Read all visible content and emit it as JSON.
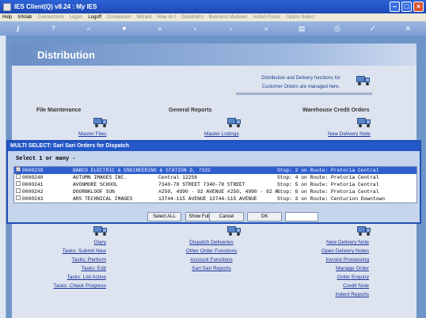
{
  "window": {
    "title": "IES Client(Q) v8.24 : My IES"
  },
  "menu": {
    "items": [
      {
        "label": "Help",
        "enabled": true
      },
      {
        "label": "Infolab",
        "enabled": true
      },
      {
        "label": "Connections",
        "enabled": false
      },
      {
        "label": "Logon",
        "enabled": false
      },
      {
        "label": "Logoff",
        "enabled": true
      },
      {
        "label": "Companion",
        "enabled": false
      },
      {
        "label": "Wizard",
        "enabled": false
      },
      {
        "label": "How do I",
        "enabled": false
      },
      {
        "label": "DataMarts",
        "enabled": false
      },
      {
        "label": "Business Modules",
        "enabled": false
      },
      {
        "label": "Action Focus",
        "enabled": false
      },
      {
        "label": "Option Select",
        "enabled": false
      }
    ]
  },
  "toolbar": {
    "icons": [
      "key-icon",
      "help-icon",
      "search-icon",
      "heart-icon",
      "first-icon",
      "previous-icon",
      "next-icon",
      "last-icon",
      "page-icon",
      "print-icon",
      "check-icon",
      "close-icon"
    ],
    "glyphs": [
      "⚷",
      "?",
      "⌕",
      "♥",
      "«",
      "‹",
      "›",
      "»",
      "▤",
      "⎙",
      "✓",
      "✕"
    ]
  },
  "page": {
    "title": "Distribution",
    "info_line1": "Distribution and Delivery functions for",
    "info_line2": "Customer Orders are managed here."
  },
  "sections": {
    "file_maintenance": {
      "title": "File Maintenance",
      "link": "Master Files"
    },
    "general_reports": {
      "title": "General Reports",
      "link": "Master Listings"
    },
    "warehouse_credit": {
      "title": "Warehouse Credit Orders",
      "link": "New Delivery Note"
    }
  },
  "lower": {
    "col1": [
      "Diary",
      "Tasks: Submit New",
      "Tasks: Perform",
      "Tasks: Edit",
      "Tasks: List Active",
      "Tasks: Check Progress"
    ],
    "col2": [
      "Dispatch Deliveries",
      "Other Order Functions",
      "Account Functions",
      "Sari Sari Reports"
    ],
    "col3": [
      "New Delivery Note",
      "Open Delivery Notes",
      "Invoice Processing",
      "Manage Order",
      "Order Enquiry",
      "Credit Note",
      "Indent Reports"
    ]
  },
  "dialog": {
    "title": "MULTI SELECT: Sari Sari Orders for Dispatch",
    "prompt": "Select 1 or many -",
    "rows": [
      {
        "code": "0000239",
        "name": "BABCO ELECTRIC & ENGINEERING & STATION D, 7332",
        "addr": "",
        "route": "Stop: 2 on Route: Pretoria Central",
        "checked": true,
        "selected": true
      },
      {
        "code": "0000240",
        "name": "AUTUMN IMAGES INC.",
        "addr": "Central 12256",
        "route": "Stop: 4 on Route: Pretoria Central",
        "checked": false,
        "selected": false
      },
      {
        "code": "0000241",
        "name": "AVONMORE SCHOOL",
        "addr": "7340-78 STREET 7340-78 STREET",
        "route": "Stop: 5 on Route: Pretoria Central",
        "checked": false,
        "selected": false
      },
      {
        "code": "0000242",
        "name": "DOORNKLOOF SUN",
        "addr": "#250, 4990 - 92 AVENUE #250, 4990 - 92 A",
        "route": "Stop: 6 on Route: Pretoria Central",
        "checked": false,
        "selected": false
      },
      {
        "code": "0000243",
        "name": "ARS TECHNICAL IMAGES",
        "addr": "13744-115 AVENUE 13744-115 AVENUE",
        "route": "Stop: 3 on Route: Centurion Downtown",
        "checked": false,
        "selected": false
      }
    ],
    "buttons": {
      "select_all": "Select ALL",
      "show_full_line": "Show Full Line",
      "cancel": "Cancel",
      "ok": "OK"
    },
    "text_value": ""
  }
}
